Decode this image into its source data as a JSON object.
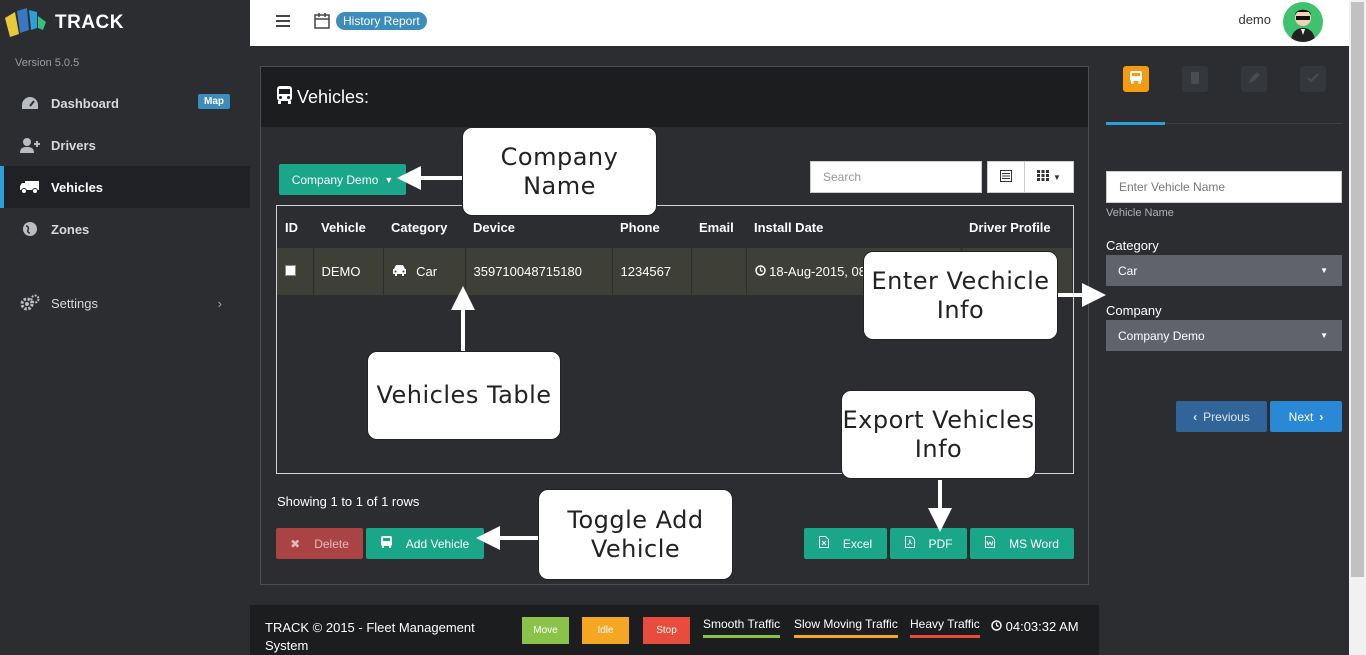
{
  "brand": {
    "name": "TRACK",
    "version": "Version 5.0.5"
  },
  "sidebar": {
    "items": [
      {
        "label": "Dashboard",
        "icon": "dashboard-icon",
        "badge": "Map"
      },
      {
        "label": "Drivers",
        "icon": "add-user-icon"
      },
      {
        "label": "Vehicles",
        "icon": "truck-icon",
        "active": true
      },
      {
        "label": "Zones",
        "icon": "globe-icon"
      },
      {
        "label": "Settings",
        "icon": "gears-icon",
        "chevron": "›"
      }
    ]
  },
  "topbar": {
    "history_badge": "History Report",
    "user": "demo"
  },
  "main": {
    "title": "Vehicles:",
    "company_button": "Company Demo",
    "search_placeholder": "Search",
    "table": {
      "headers": [
        "ID",
        "Vehicle",
        "Category",
        "Device",
        "Phone",
        "Email",
        "Install Date",
        "Driver Profile"
      ],
      "rows": [
        {
          "vehicle": "DEMO",
          "category": "Car",
          "device": "359710048715180",
          "phone": "1234567",
          "email": "",
          "install_date": "18-Aug-2015, 08"
        }
      ]
    },
    "showing": "Showing 1 to 1 of 1 rows",
    "buttons": {
      "delete": "Delete",
      "add": "Add Vehicle",
      "excel": "Excel",
      "pdf": "PDF",
      "word": "MS Word"
    }
  },
  "right_panel": {
    "vehicle_name_placeholder": "Enter Vehicle Name",
    "vehicle_name_help": "Vehicle Name",
    "category_label": "Category",
    "category_value": "Car",
    "company_label": "Company",
    "company_value": "Company Demo",
    "prev": "Previous",
    "next": "Next"
  },
  "footer": {
    "copyright": "TRACK © 2015 - Fleet Management System",
    "legend": [
      {
        "label": "Move",
        "color": "#8bc34a"
      },
      {
        "label": "Idle",
        "color": "#f5a623"
      },
      {
        "label": "Stop",
        "color": "#e74c3c"
      }
    ],
    "traffic": [
      {
        "label": "Smooth Traffic",
        "color": "#8bc34a"
      },
      {
        "label": "Slow Moving Traffic",
        "color": "#f5a623"
      },
      {
        "label": "Heavy Traffic",
        "color": "#e74c3c"
      }
    ],
    "time": "04:03:32 AM"
  },
  "callouts": {
    "company_name": "Company Name",
    "enter_info": "Enter Vechicle Info",
    "vehicles_table": "Vehicles Table",
    "export": "Export Vehicles Info",
    "toggle_add": "Toggle Add Vehicle"
  },
  "colors": {
    "accent": "#1aa688",
    "primary": "#3c8dbc",
    "danger": "#a44444"
  }
}
